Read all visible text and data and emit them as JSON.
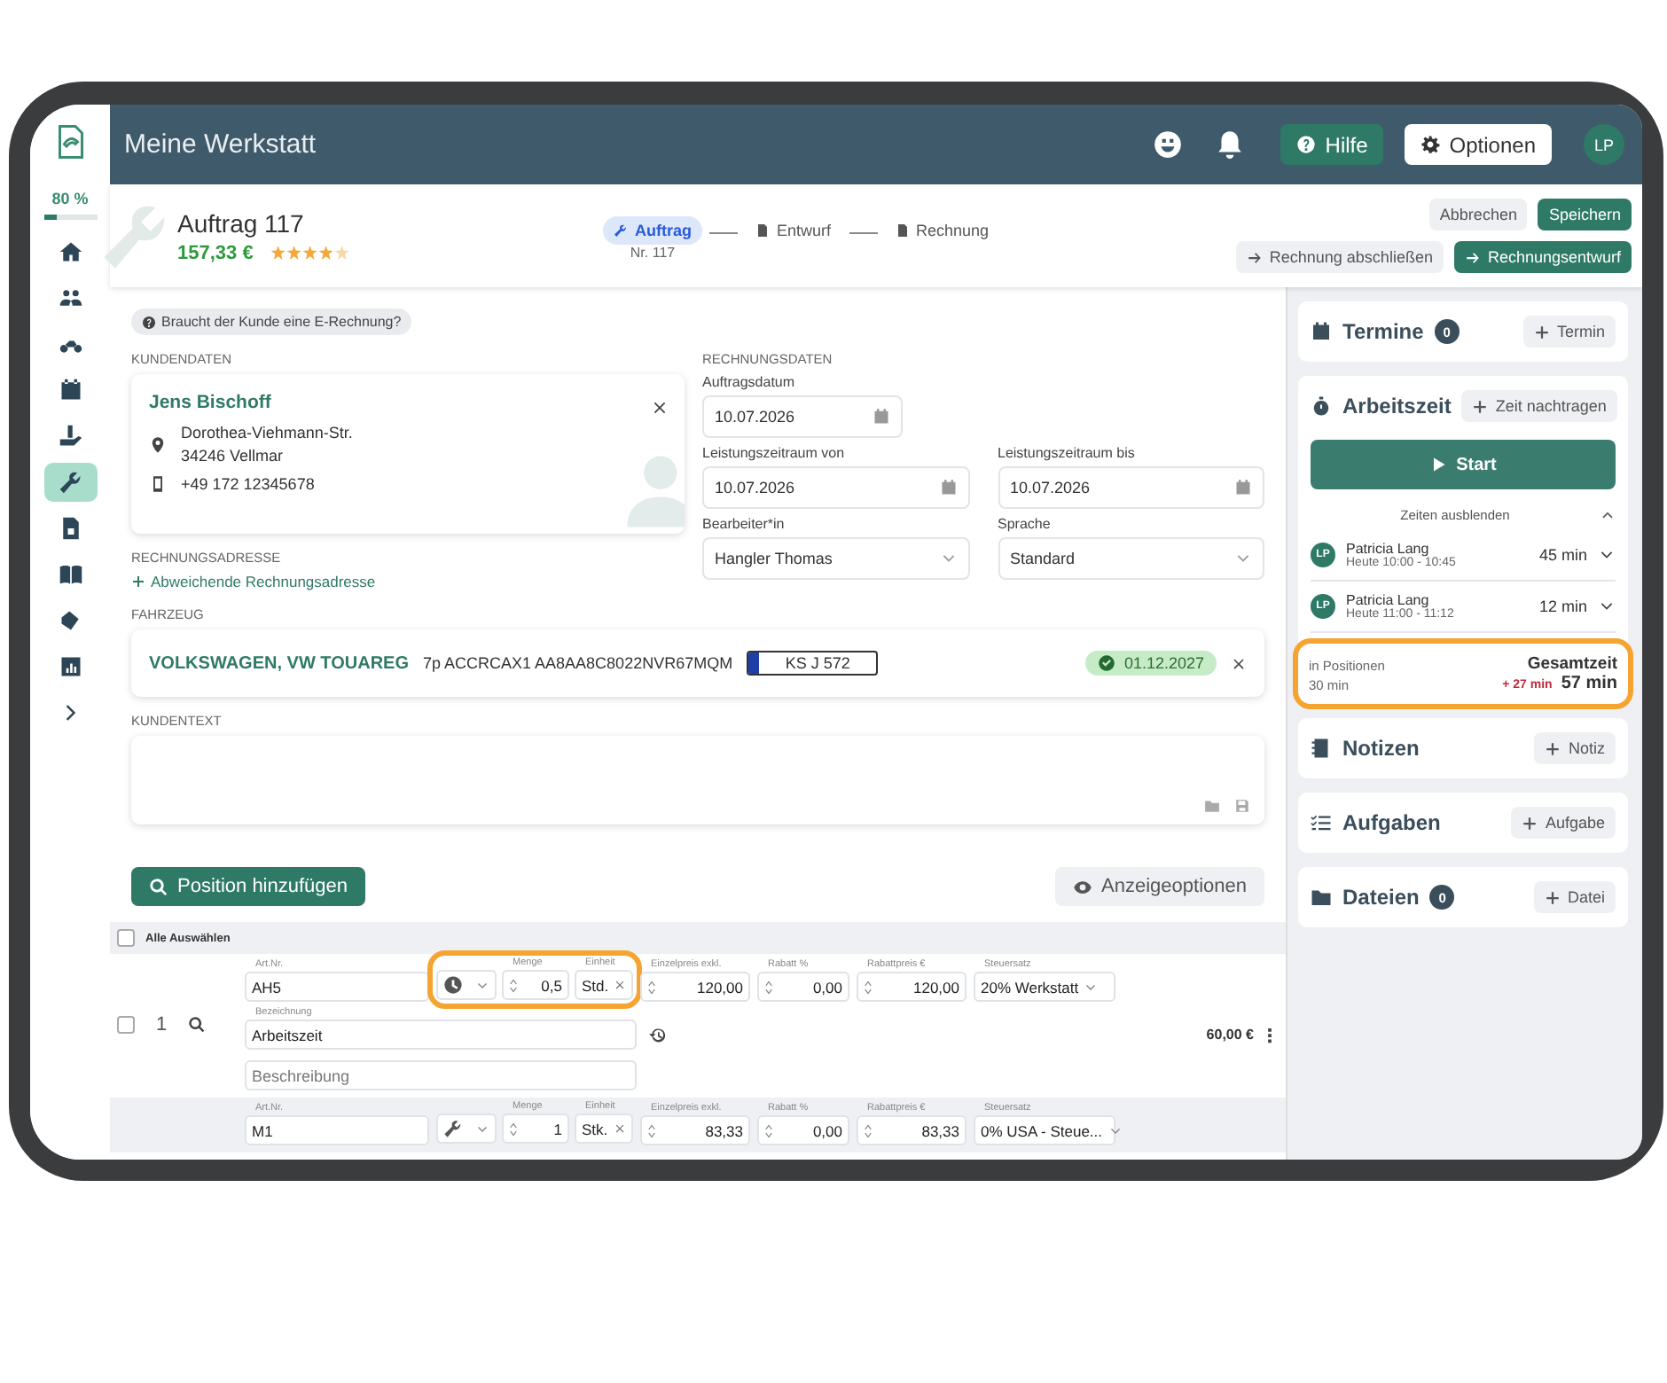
{
  "sidebar": {
    "progress": {
      "label": "80 %",
      "level": 0.25
    },
    "items": [
      {
        "kind": "home",
        "selected": false
      },
      {
        "kind": "people",
        "selected": false
      },
      {
        "kind": "moto",
        "selected": false
      },
      {
        "kind": "calendar",
        "selected": false
      },
      {
        "kind": "hand",
        "selected": false
      },
      {
        "kind": "wrench",
        "selected": true
      },
      {
        "kind": "doc",
        "selected": false
      },
      {
        "kind": "book",
        "selected": false
      },
      {
        "kind": "tags",
        "selected": false
      },
      {
        "kind": "chart",
        "selected": false
      },
      {
        "kind": "chevron",
        "selected": false
      }
    ]
  },
  "topbar": {
    "title": "Meine Werkstatt",
    "help_button": "Hilfe",
    "options_button": "Optionen",
    "avatar": "LP"
  },
  "order": {
    "title": "Auftrag 117",
    "amount": "157,33 €",
    "stars": 4,
    "steps": [
      {
        "label": "Auftrag",
        "sub": "Nr. 117",
        "selected": true
      },
      {
        "label": "Entwurf",
        "selected": false
      },
      {
        "label": "Rechnung",
        "selected": false
      }
    ],
    "cancel_button": "Abbrechen",
    "save_button": "Speichern",
    "finish_button": "Rechnung abschließen",
    "draft_button": "Rechnungsentwurf"
  },
  "einvoice_chip": "Braucht der Kunde eine E-Rechnung?",
  "customer": {
    "section": "KUNDENDATEN",
    "name": "Jens Bischoff",
    "street": "Dorothea-Viehmann-Str.",
    "city": "34246 Vellmar",
    "phone": "+49 172 12345678"
  },
  "billing": {
    "section": "RECHNUNGSADRESSE",
    "link": "Abweichende Rechnungsadresse"
  },
  "invoice_data": {
    "section": "RECHNUNGSDATEN",
    "fields": [
      {
        "label": "Auftragsdatum",
        "value": "10.07.2026",
        "kind": "date"
      },
      {
        "label": "Leistungszeitraum von",
        "value": "10.07.2026",
        "kind": "date"
      },
      {
        "label": "Leistungszeitraum bis",
        "value": "10.07.2026",
        "kind": "date"
      },
      {
        "label": "Bearbeiter*in",
        "value": "Hangler Thomas",
        "kind": "select"
      },
      {
        "label": "Sprache",
        "value": "Standard",
        "kind": "select"
      }
    ]
  },
  "vehicle": {
    "section": "FAHRZEUG",
    "make": "VOLKSWAGEN, VW TOUAREG",
    "details": "7p ACCRCAX1 AA8AA8C8022NVR67MQM",
    "plate": "KS J 572",
    "inspection": "01.12.2027"
  },
  "customer_text": {
    "section": "KUNDENTEXT"
  },
  "positions": {
    "add_button": "Position hinzufügen",
    "view_button": "Anzeigeoptionen",
    "select_all": {
      "label": "Alle Auswählen",
      "checked": false
    },
    "rows": [
      {
        "number": "1",
        "checked": false,
        "kind": "time",
        "highlighted": true,
        "article": {
          "label": "Art.Nr.",
          "value": "AH5"
        },
        "quantity": {
          "label": "Menge",
          "value": "0,5"
        },
        "unit": {
          "label": "Einheit",
          "value": "Std."
        },
        "price": {
          "label": "Einzelpreis exkl.",
          "value": "120,00"
        },
        "discount": {
          "label": "Rabatt %",
          "value": "0,00"
        },
        "discount_price": {
          "label": "Rabattpreis €",
          "value": "120,00"
        },
        "tax": {
          "label": "Steuersatz",
          "value": "20% Werkstatt"
        },
        "designation": {
          "label": "Bezeichnung",
          "value": "Arbeitszeit"
        },
        "description": {
          "placeholder": "Beschreibung"
        },
        "total": "60,00 €"
      },
      {
        "kind": "part",
        "highlighted": false,
        "article": {
          "label": "Art.Nr.",
          "value": "M1"
        },
        "quantity": {
          "label": "Menge",
          "value": "1"
        },
        "unit": {
          "label": "Einheit",
          "value": "Stk."
        },
        "price": {
          "label": "Einzelpreis exkl.",
          "value": "83,33"
        },
        "discount": {
          "label": "Rabatt %",
          "value": "0,00"
        },
        "discount_price": {
          "label": "Rabattpreis €",
          "value": "83,33"
        },
        "tax": {
          "label": "Steuersatz",
          "value": "0% USA - Steue..."
        }
      }
    ]
  },
  "panel": {
    "appointments": {
      "title": "Termine",
      "count": "0",
      "button": "Termin"
    },
    "worktime": {
      "title": "Arbeitszeit",
      "add_button": "Zeit nachtragen",
      "start_button": "Start",
      "toggle": "Zeiten ausblenden",
      "expanded": true,
      "entries": [
        {
          "initials": "LP",
          "name": "Patricia Lang",
          "time": "Heute 10:00 - 10:45",
          "duration": "45 min"
        },
        {
          "initials": "LP",
          "name": "Patricia Lang",
          "time": "Heute 11:00 - 11:12",
          "duration": "12 min"
        }
      ],
      "summary": {
        "highlighted": true,
        "positions_label": "in Positionen",
        "positions_time": "30 min",
        "total_label": "Gesamtzeit",
        "difference": "+ 27 min",
        "total": "57 min"
      }
    },
    "notes": {
      "title": "Notizen",
      "button": "Notiz"
    },
    "tasks": {
      "title": "Aufgaben",
      "button": "Aufgabe"
    },
    "files": {
      "title": "Dateien",
      "count": "0",
      "button": "Datei"
    }
  }
}
